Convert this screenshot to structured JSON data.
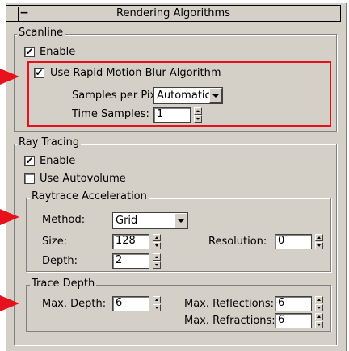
{
  "rollout": {
    "title": "Rendering Algorithms",
    "collapse_symbol": "−"
  },
  "scanline": {
    "title": "Scanline",
    "enable_label": "Enable",
    "enable_checked": true,
    "motion_blur_label": "Use Rapid Motion Blur Algorithm",
    "motion_blur_checked": true,
    "samples_label": "Samples per Pixel:",
    "samples_value": "Automatic",
    "time_samples_label": "Time Samples:",
    "time_samples_value": "1"
  },
  "raytracing": {
    "title": "Ray Tracing",
    "enable_label": "Enable",
    "enable_checked": true,
    "autovolume_label": "Use Autovolume",
    "autovolume_checked": false,
    "accel": {
      "title": "Raytrace Acceleration",
      "method_label": "Method:",
      "method_value": "Grid",
      "size_label": "Size:",
      "size_value": "128",
      "resolution_label": "Resolution:",
      "resolution_value": "0",
      "depth_label": "Depth:",
      "depth_value": "2"
    },
    "trace_depth": {
      "title": "Trace Depth",
      "max_depth_label": "Max. Depth:",
      "max_depth_value": "6",
      "max_reflections_label": "Max. Reflections:",
      "max_reflections_value": "6",
      "max_refractions_label": "Max. Refractions:",
      "max_refractions_value": "6"
    }
  },
  "check_glyph": "✔",
  "annotation": {
    "highlight_color": "#e8111b"
  }
}
